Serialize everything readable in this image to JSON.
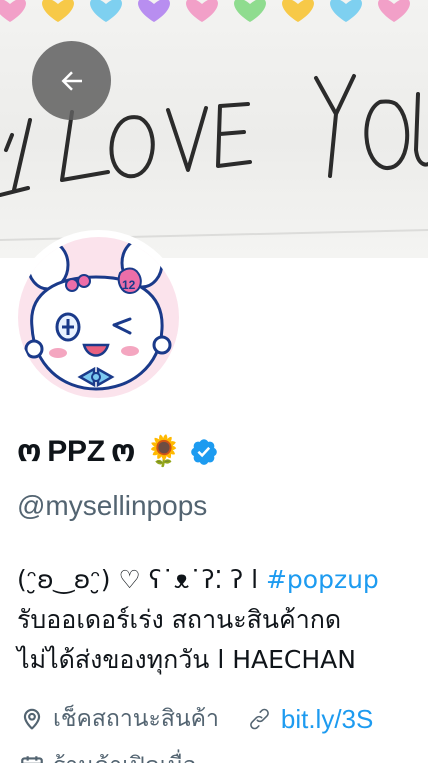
{
  "banner": {
    "handwriting": "I LOVE YOU",
    "heart_colors": [
      "#f2a0c8",
      "#f7c948",
      "#7ed0f0",
      "#b88ef0",
      "#f2a0c8",
      "#8fdc8f",
      "#f7c948",
      "#7ed0f0",
      "#f2a0c8"
    ]
  },
  "header": {
    "back_icon": "arrow-left-icon"
  },
  "profile": {
    "display_name_prefix": "ო",
    "display_name": "PPZ",
    "display_name_suffix": "ო",
    "emoji": "🌻",
    "verified_icon": "verified-badge-icon",
    "handle": "@mysellinpops"
  },
  "bio": {
    "line1_text": "(ᵔ̮ʚ‿ʚᵔ̮) ♡ ʕ˙ᴥ˙ʔ⁚ ʔ l ",
    "line1_hashtag": "#popzup",
    "line2": "รับออเดอร์เร่ง สถานะสินค้ากด",
    "line3": "ไม่ได้ส่งของทุกวัน l HAECHAN"
  },
  "meta": {
    "location_icon": "location-pin-icon",
    "location_label": "เช็คสถานะสินค้า",
    "link_icon": "link-icon",
    "link_text": "bit.ly/3S",
    "second_row_text": "ร้านค้าเปิดเมื่อ"
  },
  "colors": {
    "accent": "#1d9bf0",
    "secondary_text": "#536471",
    "primary_text": "#0f1419",
    "avatar_bg": "#fbe3ec"
  }
}
